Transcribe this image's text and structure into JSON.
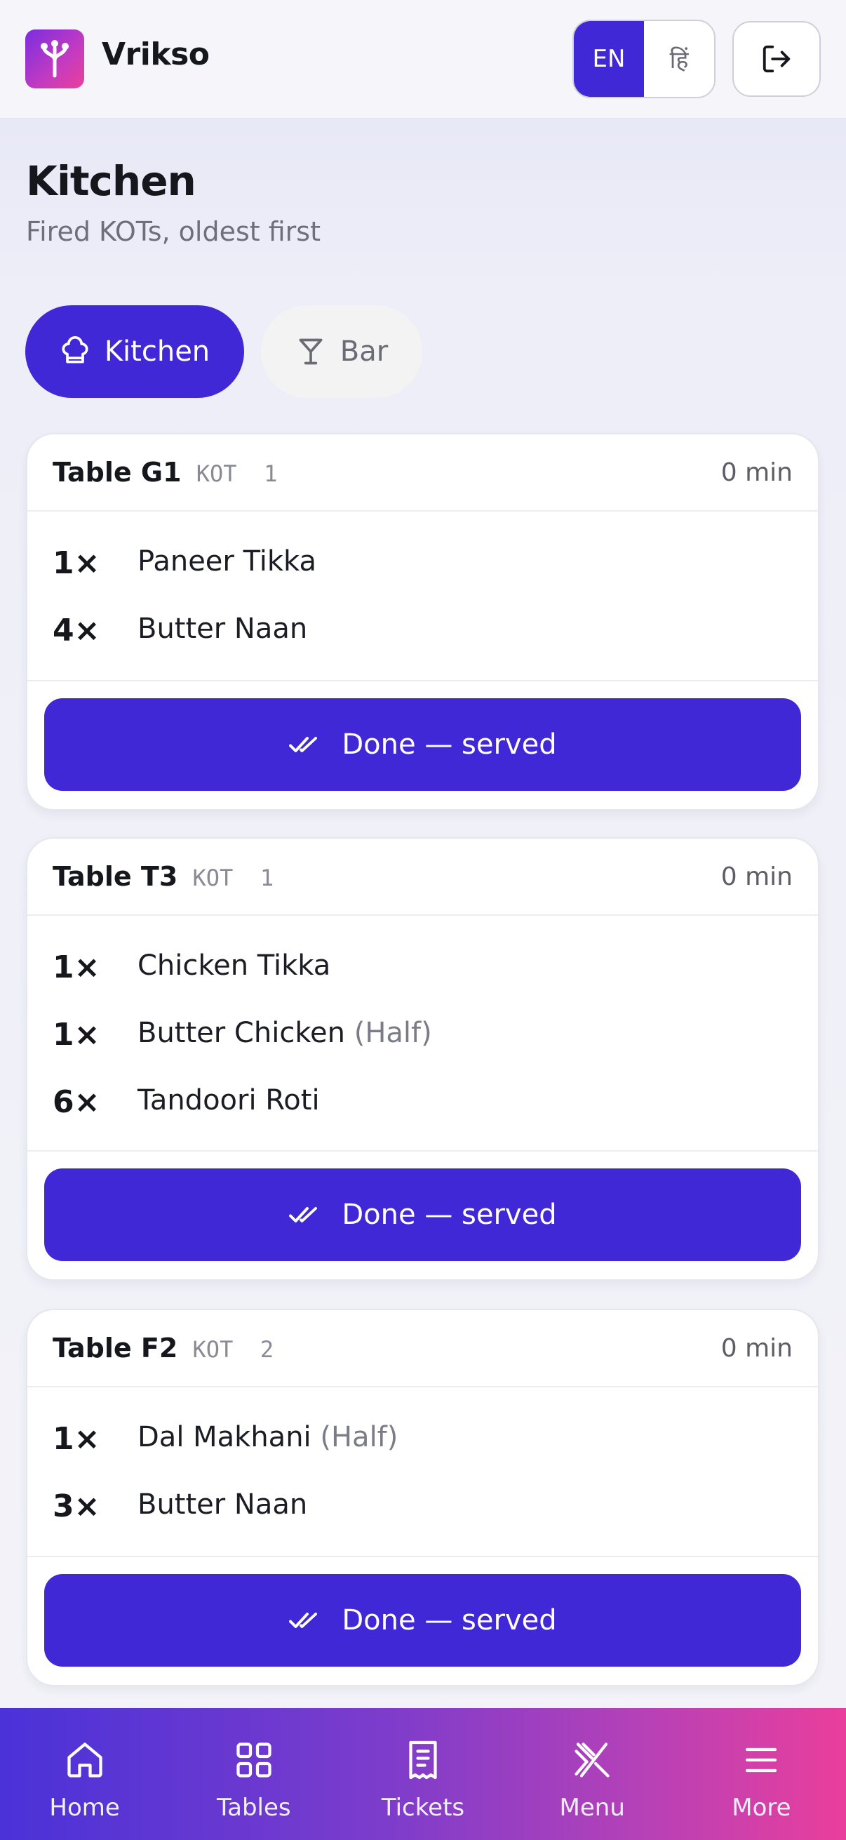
{
  "header": {
    "brand": "Vrikso",
    "lang_en": "EN",
    "lang_hi": "हिं",
    "logout_icon": "logout-icon",
    "logo_icon": "tree-logo-icon"
  },
  "page": {
    "title": "Kitchen",
    "subtitle": "Fired KOTs, oldest first"
  },
  "stations": [
    {
      "label": "Kitchen",
      "icon": "chef-hat-icon",
      "active": true
    },
    {
      "label": "Bar",
      "icon": "cocktail-glass-icon",
      "active": false
    }
  ],
  "tickets": [
    {
      "table": "Table G1",
      "kot_label": "KOT",
      "kot_no": "1",
      "elapsed": "0 min",
      "items": [
        {
          "qty": "1×",
          "name": "Paneer Tikka",
          "portion": ""
        },
        {
          "qty": "4×",
          "name": "Butter Naan",
          "portion": ""
        }
      ],
      "action": "Done — served"
    },
    {
      "table": "Table T3",
      "kot_label": "KOT",
      "kot_no": "1",
      "elapsed": "0 min",
      "items": [
        {
          "qty": "1×",
          "name": "Chicken Tikka",
          "portion": ""
        },
        {
          "qty": "1×",
          "name": "Butter Chicken",
          "portion": "(Half)"
        },
        {
          "qty": "6×",
          "name": "Tandoori Roti",
          "portion": ""
        }
      ],
      "action": "Done — served"
    },
    {
      "table": "Table F2",
      "kot_label": "KOT",
      "kot_no": "2",
      "elapsed": "0 min",
      "items": [
        {
          "qty": "1×",
          "name": "Dal Makhani",
          "portion": "(Half)"
        },
        {
          "qty": "3×",
          "name": "Butter Naan",
          "portion": ""
        }
      ],
      "action": "Done — served"
    }
  ],
  "nav": [
    {
      "label": "Home",
      "icon": "home-icon"
    },
    {
      "label": "Tables",
      "icon": "grid-icon"
    },
    {
      "label": "Tickets",
      "icon": "receipt-icon"
    },
    {
      "label": "Menu",
      "icon": "utensils-icon"
    },
    {
      "label": "More",
      "icon": "menu-icon"
    }
  ],
  "colors": {
    "accent": "#4128d6",
    "nav_gradient_start": "#4a32d8",
    "nav_gradient_end": "#ea3e9c"
  }
}
